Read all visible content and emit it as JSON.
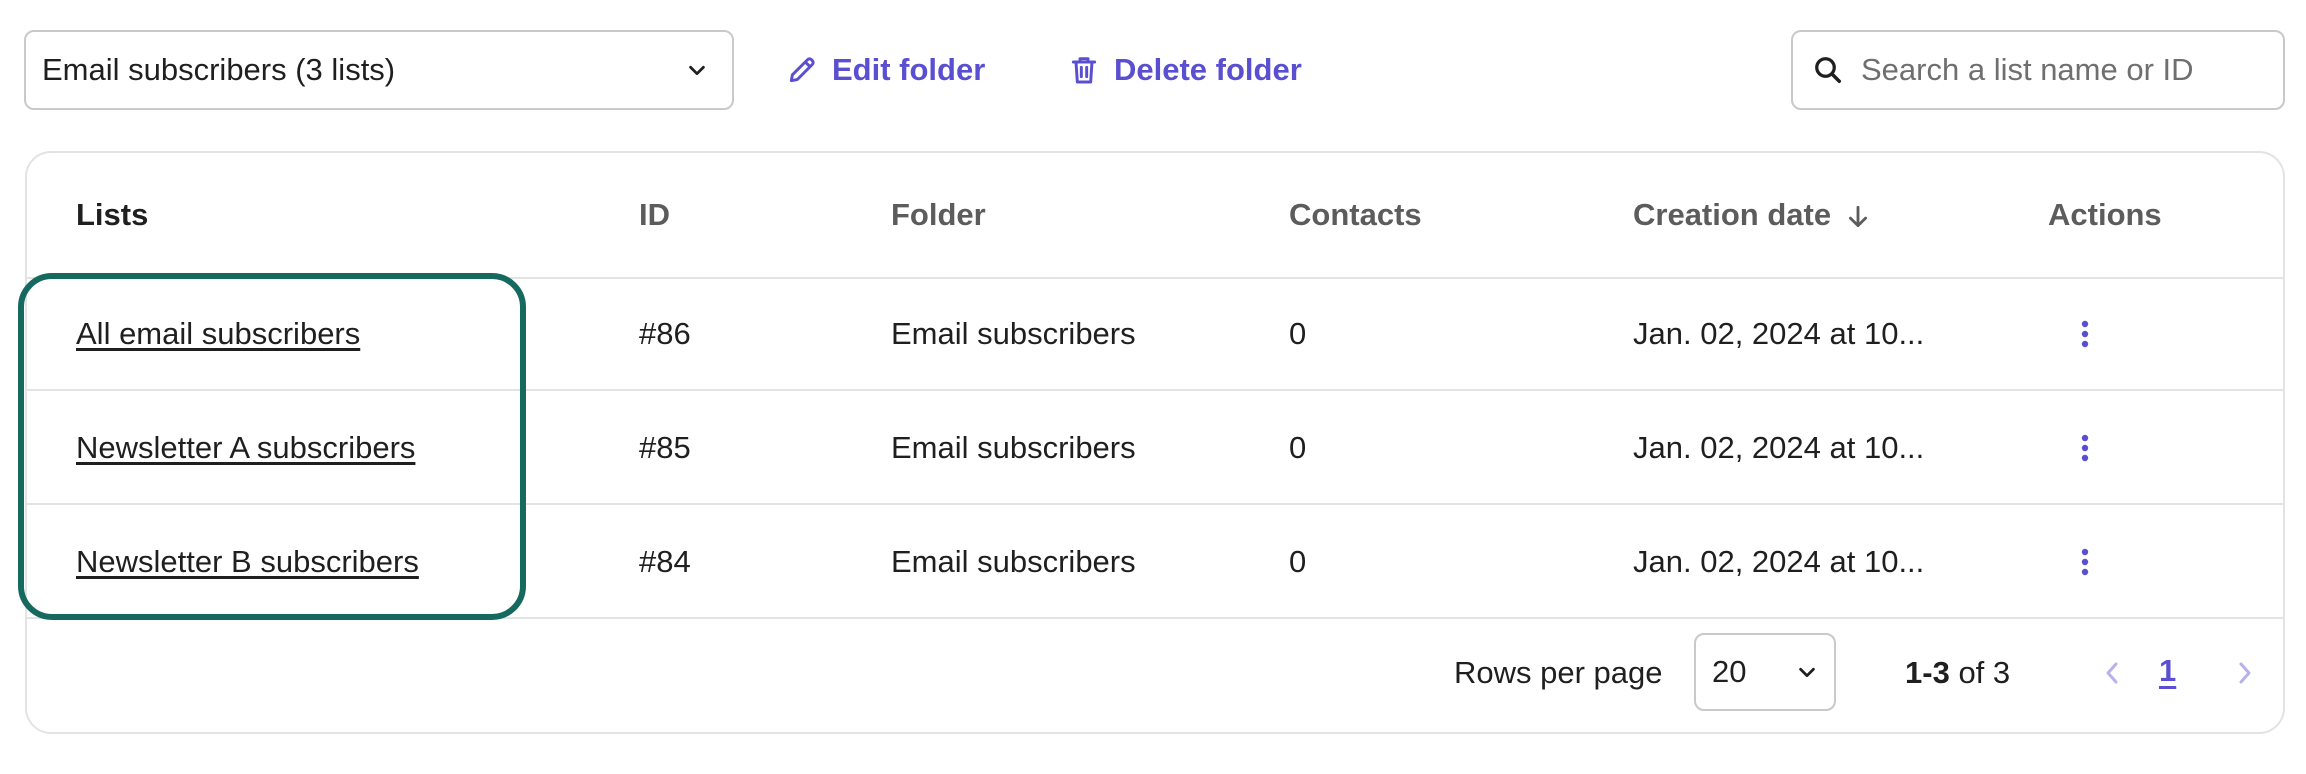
{
  "toolbar": {
    "folder_select_value": "Email subscribers (3 lists)",
    "edit_folder_label": "Edit folder",
    "delete_folder_label": "Delete folder",
    "search_placeholder": "Search a list name or ID"
  },
  "table": {
    "columns": {
      "lists": "Lists",
      "id": "ID",
      "folder": "Folder",
      "contacts": "Contacts",
      "creation_date": "Creation date",
      "actions": "Actions"
    },
    "sort": {
      "column": "creation_date",
      "direction": "descending",
      "icon": "arrow-down-icon"
    },
    "rows": [
      {
        "name": "All email subscribers",
        "id": "#86",
        "folder": "Email subscribers",
        "contacts": "0",
        "created": "Jan. 02, 2024 at 10..."
      },
      {
        "name": "Newsletter A subscribers",
        "id": "#85",
        "folder": "Email subscribers",
        "contacts": "0",
        "created": "Jan. 02, 2024 at 10..."
      },
      {
        "name": "Newsletter B subscribers",
        "id": "#84",
        "folder": "Email subscribers",
        "contacts": "0",
        "created": "Jan. 02, 2024 at 10..."
      }
    ]
  },
  "pagination": {
    "rows_per_page_label": "Rows per page",
    "rows_per_page_value": "20",
    "range": "1-3",
    "of_label": "of 3",
    "current_page": "1"
  },
  "colors": {
    "accent": "#5b4fd1",
    "highlight": "#16695f",
    "border": "#e3e3e3"
  },
  "icons": [
    "chevron-down-icon",
    "pencil-icon",
    "trash-icon",
    "search-icon",
    "arrow-down-icon",
    "kebab-menu-icon",
    "chevron-left-icon",
    "chevron-right-icon"
  ]
}
